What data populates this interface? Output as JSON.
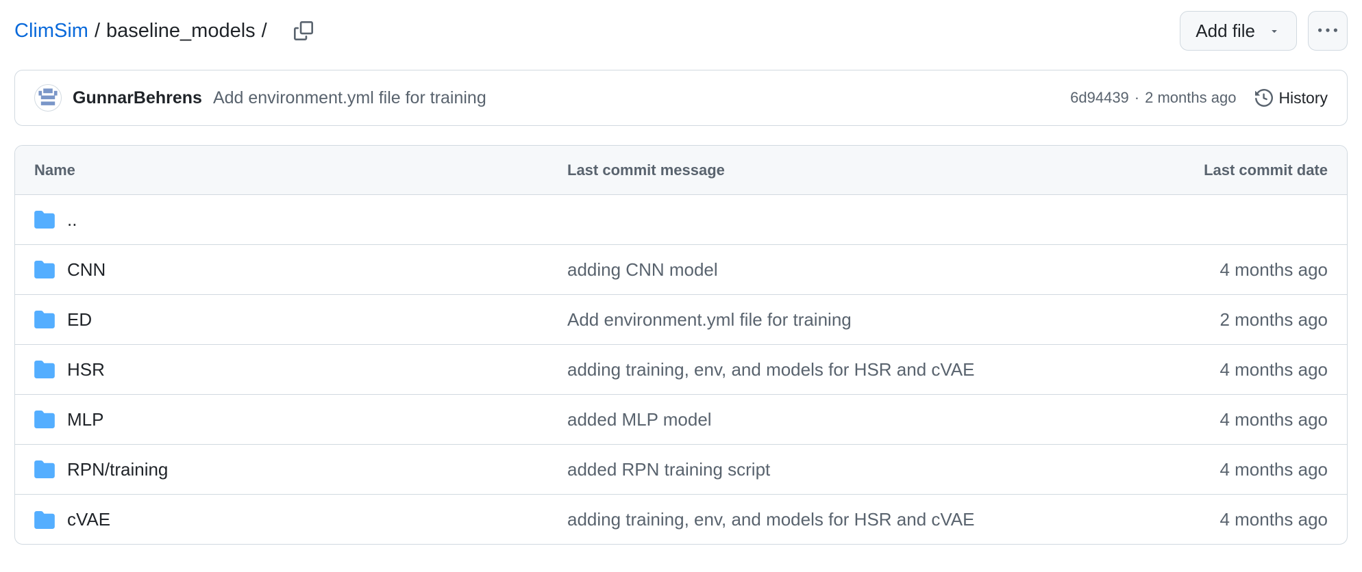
{
  "breadcrumb": {
    "repo": "ClimSim",
    "separator": "/",
    "folder": "baseline_models",
    "trailing": "/"
  },
  "header_actions": {
    "add_file_label": "Add file"
  },
  "latest_commit": {
    "author": "GunnarBehrens",
    "message": "Add environment.yml file for training",
    "hash": "6d94439",
    "separator": "·",
    "time": "2 months ago",
    "history_label": "History"
  },
  "table": {
    "headers": {
      "name": "Name",
      "message": "Last commit message",
      "date": "Last commit date"
    },
    "rows": [
      {
        "name": "..",
        "message": "",
        "date": ""
      },
      {
        "name": "CNN",
        "message": "adding CNN model",
        "date": "4 months ago"
      },
      {
        "name": "ED",
        "message": "Add environment.yml file for training",
        "date": "2 months ago"
      },
      {
        "name": "HSR",
        "message": "adding training, env, and models for HSR and cVAE",
        "date": "4 months ago"
      },
      {
        "name": "MLP",
        "message": "added MLP model",
        "date": "4 months ago"
      },
      {
        "name": "RPN/training",
        "message": "added RPN training script",
        "date": "4 months ago"
      },
      {
        "name": "cVAE",
        "message": "adding training, env, and models for HSR and cVAE",
        "date": "4 months ago"
      }
    ]
  },
  "icons": {
    "copy": "copy-icon",
    "dropdown": "triangle-down-icon",
    "more": "kebab-horizontal-icon",
    "history": "history-icon",
    "folder": "folder-icon"
  },
  "colors": {
    "link": "#0969da",
    "text": "#1f2328",
    "muted": "#59636e",
    "border": "#d1d9e0",
    "header_bg": "#f6f8fa",
    "folder": "#54aeff"
  }
}
